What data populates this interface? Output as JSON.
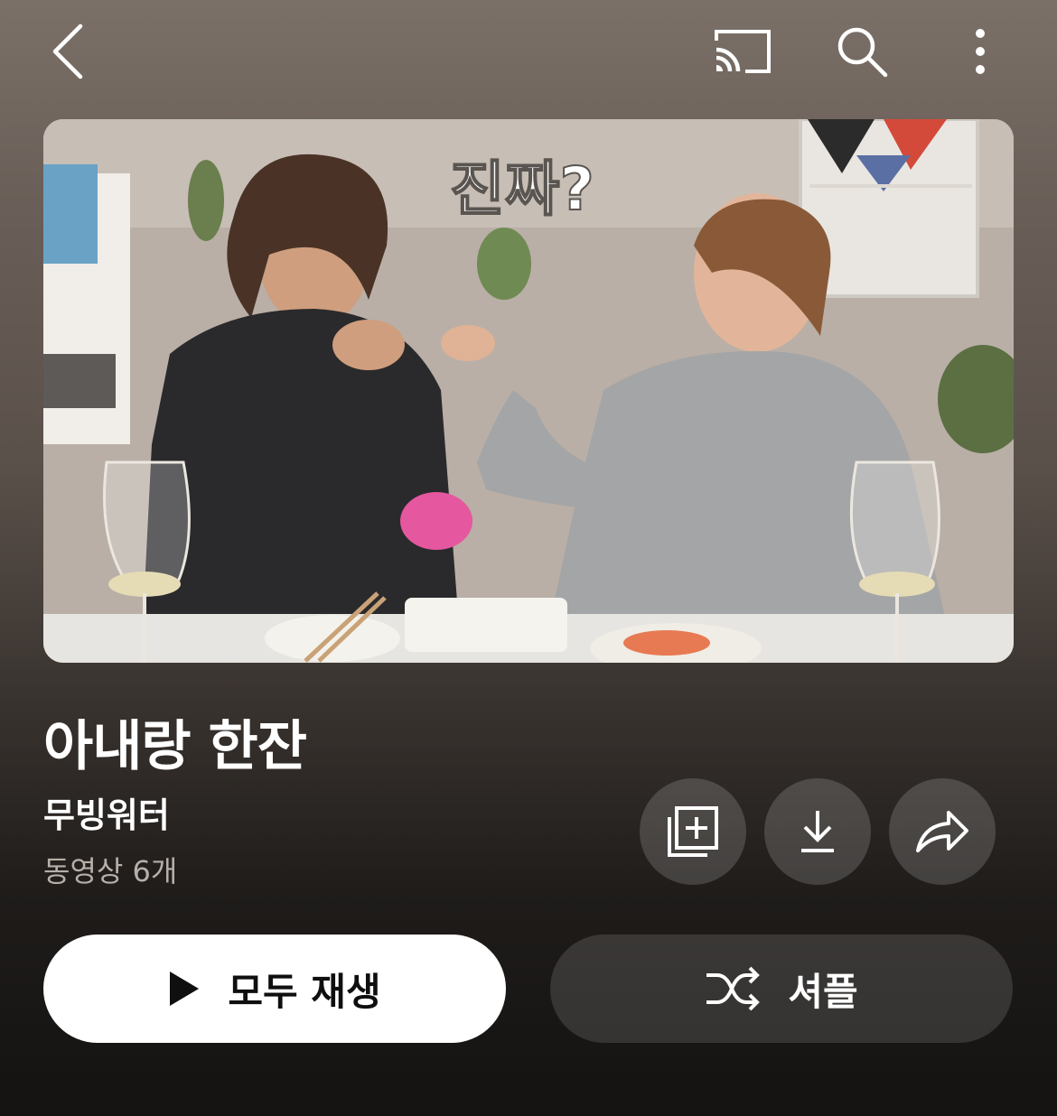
{
  "header": {
    "back_icon": "chevron-left-icon",
    "cast_icon": "cast-icon",
    "search_icon": "search-icon",
    "more_icon": "more-vertical-icon"
  },
  "thumbnail": {
    "overlay_text": "진짜?"
  },
  "playlist": {
    "title": "아내랑 한잔",
    "channel": "무빙워터",
    "video_count": "동영상 6개"
  },
  "actions": {
    "save_icon": "add-to-library-icon",
    "download_icon": "download-icon",
    "share_icon": "share-icon"
  },
  "buttons": {
    "play_all_label": "모두 재생",
    "shuffle_label": "셔플"
  },
  "colors": {
    "play_button_bg": "#ffffff",
    "shuffle_button_bg": "#3d3835"
  }
}
